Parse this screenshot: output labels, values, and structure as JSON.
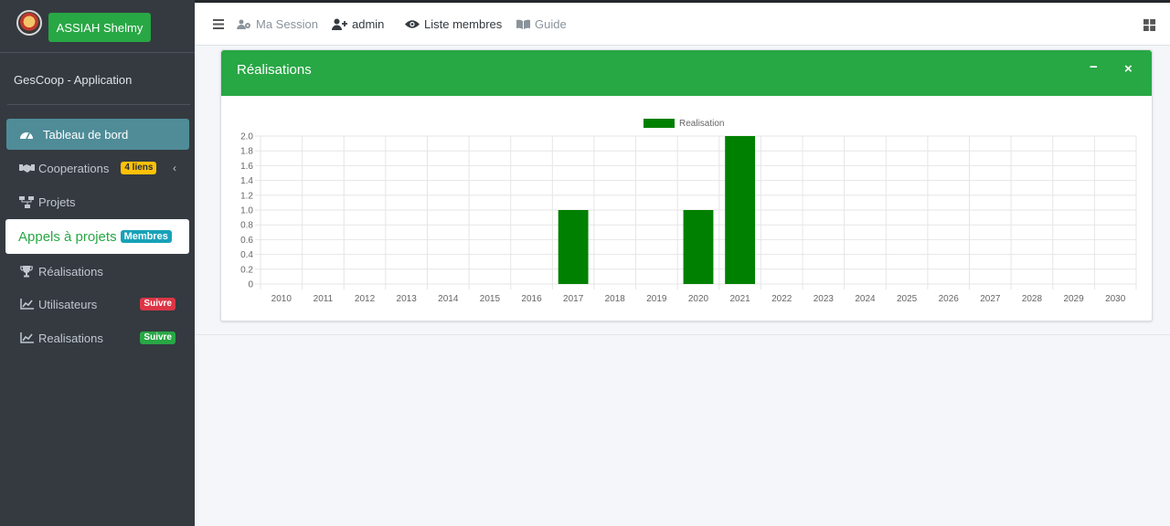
{
  "sidebar": {
    "user_button": "ASSIAH Shelmy",
    "app_name": "GesCoop - Application",
    "items": [
      {
        "label": "Tableau de bord"
      },
      {
        "label": "Cooperations",
        "badge": "4 liens"
      },
      {
        "label": "Projets"
      },
      {
        "label": "Appels à projets",
        "badge": "Membres"
      },
      {
        "label": "Réalisations"
      },
      {
        "label": "Utilisateurs",
        "badge": "Suivre"
      },
      {
        "label": "Realisations",
        "badge": "Suivre"
      }
    ]
  },
  "navbar": {
    "links": [
      {
        "label": "Ma Session"
      },
      {
        "label": "admin"
      },
      {
        "label": "Liste membres"
      },
      {
        "label": "Guide"
      }
    ]
  },
  "card": {
    "title": "Réalisations",
    "minimize": "−",
    "close": "×"
  },
  "chart_data": {
    "type": "bar",
    "legend": "Realisation",
    "legend_position": "top",
    "color": "#008000",
    "grid": true,
    "categories": [
      "2010",
      "2011",
      "2012",
      "2013",
      "2014",
      "2015",
      "2016",
      "2017",
      "2018",
      "2019",
      "2020",
      "2021",
      "2022",
      "2023",
      "2024",
      "2025",
      "2026",
      "2027",
      "2028",
      "2029",
      "2030"
    ],
    "values": [
      0,
      0,
      0,
      0,
      0,
      0,
      0,
      1,
      0,
      0,
      1,
      2,
      0,
      0,
      0,
      0,
      0,
      0,
      0,
      0,
      0
    ],
    "ylim": [
      0,
      2
    ],
    "yticks": [
      "0",
      "0.2",
      "0.4",
      "0.6",
      "0.8",
      "1.0",
      "1.2",
      "1.4",
      "1.6",
      "1.8",
      "2.0"
    ]
  }
}
